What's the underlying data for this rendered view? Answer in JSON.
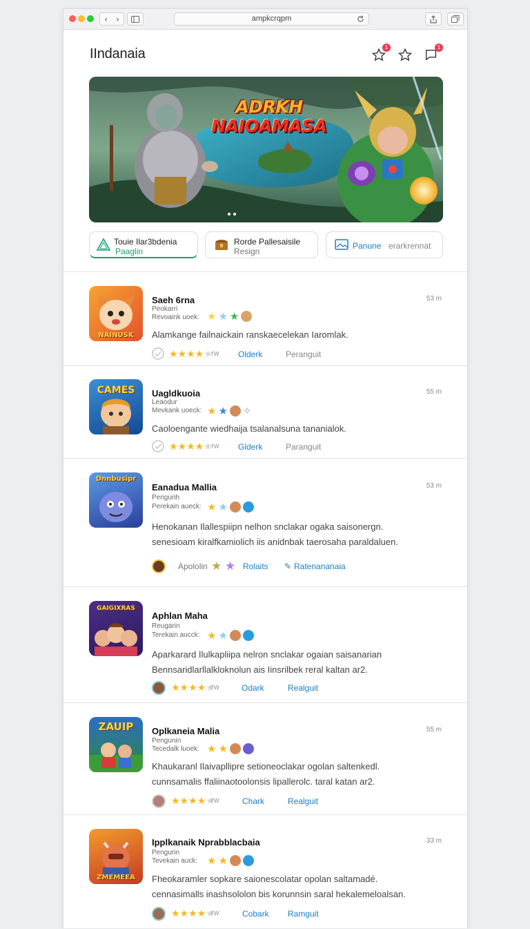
{
  "browser": {
    "url": "ampkcrqpm"
  },
  "header": {
    "title": "IIndanaia",
    "notif_badge_1": "1",
    "notif_badge_2": "1"
  },
  "hero": {
    "title_line1": "ADRKH",
    "title_line2": "NAIOAMASA"
  },
  "chips": [
    {
      "line1": "Touie Ilar3bdenia",
      "line2": "Paaglin",
      "color": "#1f9a74"
    },
    {
      "line1": "Rorde Pallesaisile",
      "line2": "Resign",
      "color": "#777777"
    },
    {
      "line1": "Panune",
      "line2": "erarkrennat",
      "color": "#1a7fc4"
    }
  ],
  "items": [
    {
      "name": "Saeh 6rna",
      "sub1": "Peokarri",
      "sub2": "Revoaink uoek:",
      "time": "53 m",
      "desc": [
        "Alamkange failnaickain ranskaecelekan Iaromlak."
      ],
      "stars_text": "rw",
      "action1": "Olderk",
      "action2": "Peranguit",
      "thumb_text": "NAINUSK"
    },
    {
      "name": "Uagldkuoia",
      "sub1": "Leaodur",
      "sub2": "Mevkank uoeck:",
      "time": "55 m",
      "desc": [
        "Caoloengante wiedhaija tsalanalsuna tananialok."
      ],
      "stars_text": "rw",
      "action1": "Glderk",
      "action2": "Paranguit",
      "thumb_text": "CAMES"
    },
    {
      "name": "Eanadua Mallia",
      "sub1": "Pengurih",
      "sub2": "Perekain aueck:",
      "time": "53 m",
      "desc": [
        "Henokanan Ilallespiipn  nelhon snclakar ogaka saisonergn.",
        "senesioam kiralfkamiolich iis anidnbak taerosaha paraldaluen."
      ],
      "stars_text": "Apololin",
      "action1": "Rolaits",
      "action2": "Ratenananaia",
      "thumb_text": "Dnnbusipr"
    },
    {
      "name": "Aphlan Maha",
      "sub1": "Reugarin",
      "sub2": "Terekain aucck:",
      "time": "",
      "desc": [
        "Aparkarard Ilulkapliipa  nelron snclakar ogaian saisanarian",
        "Bennsaridlarllalkloknolun ais Iinsrilbek reral kaltan ar2."
      ],
      "stars_text": "rw",
      "action1": "Odark",
      "action2": "Realguit",
      "thumb_text": "GAIGIXRAS"
    },
    {
      "name": "Oplkaneia Malia",
      "sub1": "Pengunin",
      "sub2": "Tecedalk luoek:",
      "time": "55 m",
      "desc": [
        "Khaukaranl Ilaivapllipre  setioneoclakar ogolan saltenkedl.",
        "cunnsamalis ffaliinaotoolonsis lipallerolc. taral katan ar2."
      ],
      "stars_text": "rw",
      "action1": "Chark",
      "action2": "Realguit",
      "thumb_text": "ZAUIP"
    },
    {
      "name": "Ipplkanaik Nprabblacbaia",
      "sub1": "Pengurin",
      "sub2": "Tevekain auck:",
      "time": "33 m",
      "desc": [
        "Fheokaramler sopkare saionescolatar opolan saltamadé.",
        "cennasimalls inashsololon bis korunnsin saral hekalemeloalsan."
      ],
      "stars_text": "rw",
      "action1": "Cobark",
      "action2": "Ramguit",
      "thumb_text": "ZMEMEEA"
    }
  ],
  "colors": {
    "accent_blue": "#1a7fc4",
    "accent_green": "#1f9a74",
    "star_gold": "#f4b824",
    "badge_red": "#f2385a"
  }
}
